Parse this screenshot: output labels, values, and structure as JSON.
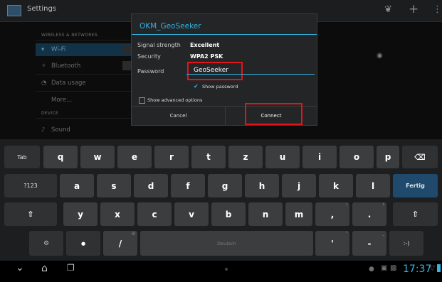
{
  "app": {
    "title": "Settings"
  },
  "actionbar": {
    "icons": [
      "wifi-scan-icon",
      "add-icon",
      "overflow-menu-icon"
    ],
    "wifi_scan_glyph": "❦",
    "add_glyph": "+",
    "overflow_glyph": "⋮"
  },
  "settings": {
    "section_wireless": "WIRELESS & NETWORKS",
    "wifi": "Wi-Fi",
    "bluetooth": "Bluetooth",
    "data_usage": "Data usage",
    "more": "More...",
    "section_device": "DEVICE",
    "sound": "Sound"
  },
  "dialog": {
    "title": "OKM_GeoSeeker",
    "signal_label": "Signal strength",
    "signal_value": "Excellent",
    "security_label": "Security",
    "security_value": "WPA2 PSK",
    "password_label": "Password",
    "password_value": "GeoSeeker",
    "show_password_label": "Show password",
    "show_password_checked": true,
    "advanced_label": "Show advanced options",
    "advanced_checked": false,
    "cancel_label": "Cancel",
    "connect_label": "Connect"
  },
  "keyboard": {
    "tab_label": "Tab",
    "row1": [
      "q",
      "w",
      "e",
      "r",
      "t",
      "z",
      "u",
      "i",
      "o",
      "p"
    ],
    "row2": [
      "a",
      "s",
      "d",
      "f",
      "g",
      "h",
      "j",
      "k",
      "l"
    ],
    "row3": [
      "y",
      "x",
      "c",
      "v",
      "b",
      "n",
      "m"
    ],
    "symbols_label": "?123",
    "enter_label": "Fertig",
    "space_label": "Deutsch",
    "comma": ",",
    "comma_hint": "!",
    "period": ".",
    "period_hint": "?",
    "slash": "/",
    "slash_hint": "@",
    "apostrophe": "'",
    "apostrophe_hint": "\"",
    "dash": "-",
    "dash_hint": "_",
    "smiley": ":-)",
    "backspace_glyph": "⌫",
    "shift_glyph": "⇧",
    "settings_glyph": "⚙",
    "mic_glyph": "●",
    "enter_color": "#1f4a6e"
  },
  "navbar": {
    "time": "17:37"
  }
}
